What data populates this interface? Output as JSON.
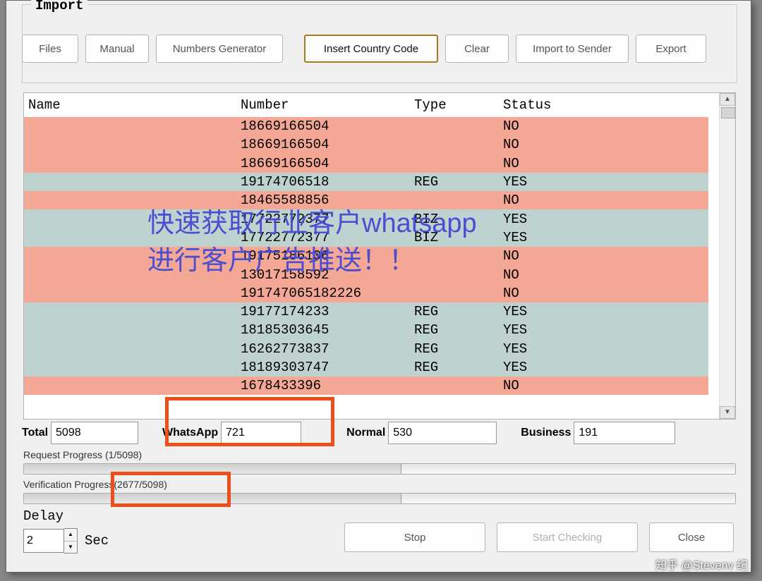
{
  "groupbox_title": "Import",
  "toolbar": {
    "files": "Files",
    "manual": "Manual",
    "numgen": "Numbers Generator",
    "insert_cc": "Insert Country Code",
    "clear": "Clear",
    "import_sender": "Import to Sender",
    "export": "Export"
  },
  "columns": {
    "name": "Name",
    "number": "Number",
    "type": "Type",
    "status": "Status"
  },
  "rows": [
    {
      "name": "",
      "number": "18669166504",
      "type": "",
      "status": "NO"
    },
    {
      "name": "",
      "number": "18669166504",
      "type": "",
      "status": "NO"
    },
    {
      "name": "",
      "number": "18669166504",
      "type": "",
      "status": "NO"
    },
    {
      "name": "",
      "number": "19174706518",
      "type": "REG",
      "status": "YES"
    },
    {
      "name": "",
      "number": "18465588856",
      "type": "",
      "status": "NO"
    },
    {
      "name": "",
      "number": "17722772377",
      "type": "BIZ",
      "status": "YES"
    },
    {
      "name": "",
      "number": "17722772377",
      "type": "BIZ",
      "status": "YES"
    },
    {
      "name": "",
      "number": "19175186106",
      "type": "",
      "status": "NO"
    },
    {
      "name": "",
      "number": "13017158592",
      "type": "",
      "status": "NO"
    },
    {
      "name": "",
      "number": "191747065182226",
      "type": "",
      "status": "NO"
    },
    {
      "name": "",
      "number": "19177174233",
      "type": "REG",
      "status": "YES"
    },
    {
      "name": "",
      "number": "18185303645",
      "type": "REG",
      "status": "YES"
    },
    {
      "name": "",
      "number": "16262773837",
      "type": "REG",
      "status": "YES"
    },
    {
      "name": "",
      "number": "18189303747",
      "type": "REG",
      "status": "YES"
    },
    {
      "name": "",
      "number": "1678433396",
      "type": "",
      "status": "NO"
    }
  ],
  "stats": {
    "total_label": "Total",
    "total_val": "5098",
    "whatsapp_label": "WhatsApp",
    "whatsapp_val": "721",
    "normal_label": "Normal",
    "normal_val": "530",
    "business_label": "Business",
    "business_val": "191"
  },
  "request_progress_label": "Request Progress (1/5098)",
  "verification_progress_label": "Verification Progress(2677/5098)",
  "delay_label": "Delay",
  "delay_value": "2",
  "delay_unit": "Sec",
  "buttons": {
    "stop": "Stop",
    "start": "Start Checking",
    "close": "Close"
  },
  "overlay_line1": "快速获取行业客户whatsapp",
  "overlay_line2": "进行客户广告推送！！",
  "watermark": "知乎 @Stevenv 纪"
}
